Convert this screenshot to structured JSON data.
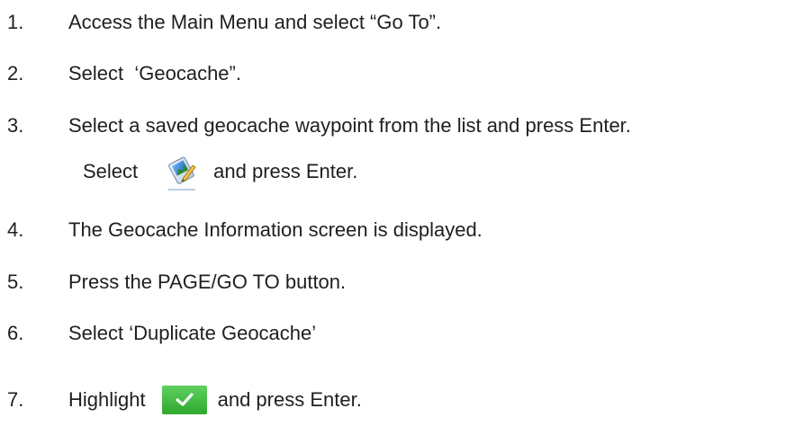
{
  "steps": [
    {
      "num": "1.",
      "text": "Access the Main Menu and select “Go To”."
    },
    {
      "num": "2.",
      "text": "Select  ‘Geocache”."
    },
    {
      "num": "3.",
      "text": "Select a saved geocache waypoint from the list and press Enter."
    },
    {
      "num": "4.",
      "text": "The Geocache Information screen is displayed."
    },
    {
      "num": "5.",
      "text": "Press the PAGE/GO TO button."
    },
    {
      "num": "6.",
      "text": "Select ‘Duplicate Geocache’"
    },
    {
      "num": "7.",
      "pre": "Highlight",
      "post": "and press Enter."
    }
  ],
  "substep": {
    "pre": "Select",
    "post": "and press Enter."
  },
  "icons": {
    "edit": "edit-waypoint-icon",
    "confirm": "checkmark-icon"
  },
  "colors": {
    "text": "#1f1f1f",
    "confirm_green": "#3dba3d"
  }
}
